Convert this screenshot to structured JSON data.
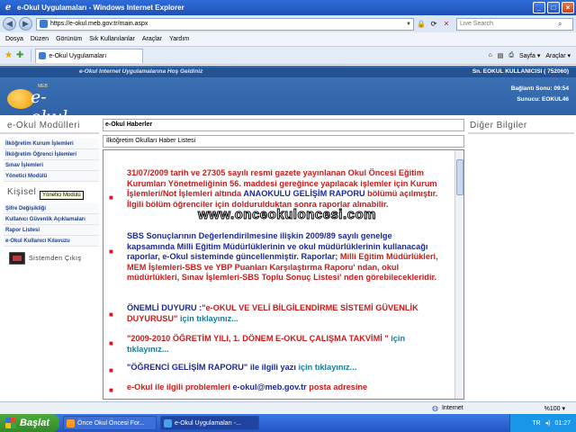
{
  "window": {
    "title": "e-Okul Uygulamaları - Windows Internet Explorer",
    "min": "_",
    "max": "□",
    "close": "×"
  },
  "address": {
    "url": "https://e-okul.meb.gov.tr/main.aspx",
    "search_placeholder": "Live Search"
  },
  "menu": [
    "Dosya",
    "Düzen",
    "Görünüm",
    "Sık Kullanılanlar",
    "Araçlar",
    "Yardım"
  ],
  "tab": {
    "label": "e-Okul Uygulamaları",
    "tools": [
      "Sayfa ▾",
      "Araçlar ▾"
    ]
  },
  "header": {
    "welcome": "e-Okul Internet Uygulamalarına Hoş Geldiniz",
    "user": "Sn. EOKUL KULLANICISI ( 752060)",
    "connection": "Bağlantı Sonu: 09:54",
    "server": "Sunucu: EOKUL46",
    "logo_text": "e-okul",
    "logo_small": "MEB"
  },
  "left": {
    "title": "e-Okul Modülleri",
    "modules": [
      "İlköğretim Kurum İşlemleri",
      "İlköğretim Öğrenci İşlemleri",
      "Sınav İşlemleri",
      "Yönetici Modülü"
    ],
    "personal_title": "Kişisel",
    "tooltip": "Yönetici Modülü",
    "personal": [
      "Şifre Değişikliği",
      "Kullanıcı Güvenlik Açıklamaları",
      "Rapor Listesi",
      "e-Okul Kullanıcı Kılavuzu"
    ],
    "logout": "Sistemden Çıkış"
  },
  "news": {
    "header": "e-Okul Haberler",
    "sub": "İlköğretim Okulları Haber Listesi",
    "watermark": "www.onceokuloncesi.com",
    "item1": {
      "text_a": "31/07/2009 tarih ve 27305 sayılı resmi gazete yayınlanan Okul Öncesi Eğitim Kurumları Yönetmeliğinin 56. maddesi gereğince yapılacak işlemler için Kurum İşlemleri/Not İşlemleri altında ",
      "link": "ANAOKULU GELİŞİM RAPORU",
      "text_b": " bölümü açılmıştır. İlgili bölüm öğrenciler için doldurulduktan sonra raporlar alınabilir."
    },
    "item2": {
      "a": "SBS Sonuçlarının Değerlendirilmesine ilişkin 2009/89 sayılı genelge kapsamında Milli Eğitim Müdürlüklerinin ve okul müdürlüklerinin kullanacağı raporlar, e-Okul sisteminde güncellenmiştir. Raporlar;",
      "b": "Milli Eğitim Müdürlükleri, MEM İşlemleri-SBS ve YBP Puanları Karşılaştırma Raporu' ndan, okul müdürlükleri, Sınav İşlemleri-SBS Toplu Sonuç Listesi' nden görebilecekleridir."
    },
    "item3": {
      "lead": "ÖNEMLİ DUYURU :",
      "main": "\"e-OKUL VE VELİ BİLGİLENDİRME SİSTEMİ GÜVENLİK DUYURUSU\"",
      "link": " için tıklayınız..."
    },
    "item4": {
      "main": "\"2009-2010 ÖĞRETİM YILI, 1. DÖNEM E-OKUL ÇALIŞMA TAKVİMİ \"",
      "link": " için tıklayınız..."
    },
    "item5": {
      "main": "\"ÖĞRENCİ GELİŞİM RAPORU\" ile ilgili yazı",
      "link": " için tıklayınız..."
    },
    "item6": {
      "a": "e-Okul ile ilgili problemleri ",
      "email": "e-okul@meb.gov.tr",
      "b": " posta adresine"
    }
  },
  "right": {
    "title": "Diğer Bilgiler"
  },
  "status": {
    "zone": "Internet",
    "zoom": "%100 ▾"
  },
  "taskbar": {
    "start": "Başlat",
    "tasks": [
      "Önce Okul Öncesi For...",
      "e-Okul Uygulamaları -..."
    ],
    "lang": "TR",
    "time": "01:27"
  },
  "colors": {
    "header_blue": "#2f62a6",
    "news_red": "#c81c1c",
    "news_blue": "#1c2a96"
  }
}
